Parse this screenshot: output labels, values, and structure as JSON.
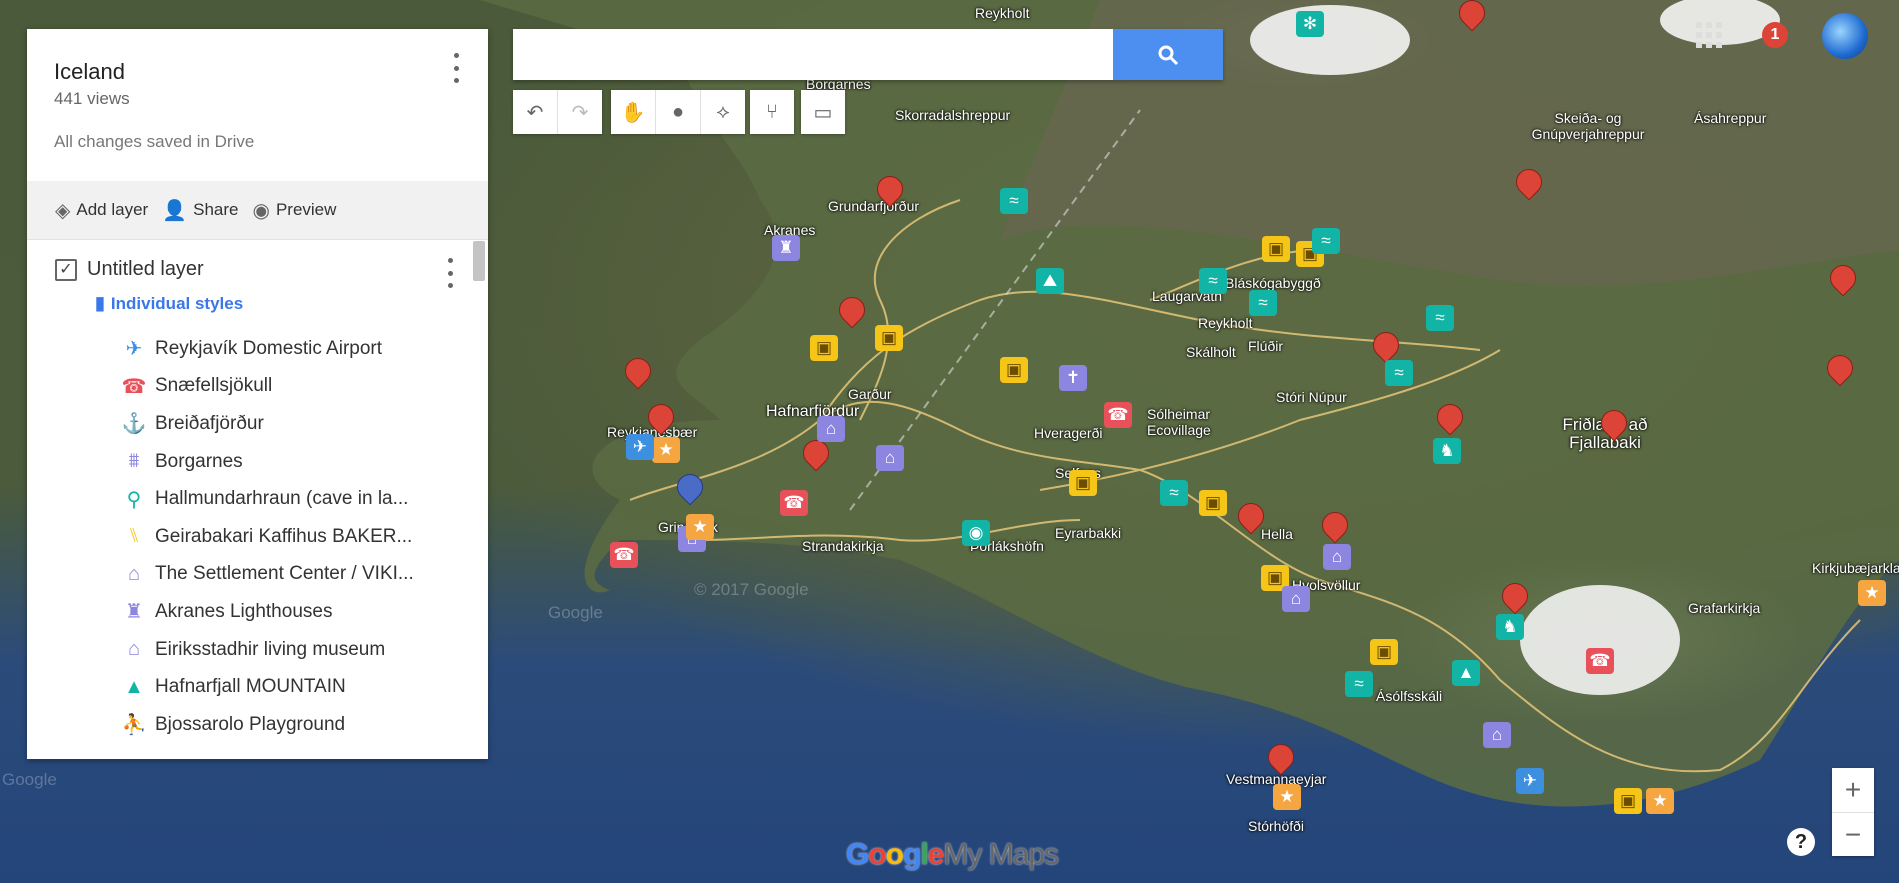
{
  "map": {
    "labels": [
      {
        "text": "Reykholt"
      },
      {
        "text": "Borgarnes"
      },
      {
        "text": "Skorradalshreppur"
      },
      {
        "text": "Grundarfjörður"
      },
      {
        "text": "Akranes"
      },
      {
        "text": "Laugarvatn"
      },
      {
        "text": "Bláskógabyggð"
      },
      {
        "text": "Reykholt"
      },
      {
        "text": "Skálholt"
      },
      {
        "text": "Flúðir"
      },
      {
        "text": "Stóri Núpur"
      },
      {
        "text": "Sólheimar Ecovillage"
      },
      {
        "text": "Reykjanesbær"
      },
      {
        "text": "Hafnarfjördur"
      },
      {
        "text": "Garður"
      },
      {
        "text": "Hveragerði"
      },
      {
        "text": "Selfoss"
      },
      {
        "text": "Eyrarbakki"
      },
      {
        "text": "Grindavík"
      },
      {
        "text": "Strandakirkja"
      },
      {
        "text": "Þorlákshöfn"
      },
      {
        "text": "Hella"
      },
      {
        "text": "Hvolsvöllur"
      },
      {
        "text": "Ásólfsskáli"
      },
      {
        "text": "Vestmannaeyjar"
      },
      {
        "text": "Stórhöfði"
      },
      {
        "text": "Skeiða- og Gnúpverjahreppur"
      },
      {
        "text": "Ásahreppur"
      },
      {
        "text": "Friðland að Fjallabaki"
      },
      {
        "text": "Kirkjubæjarklaustur"
      },
      {
        "text": "Grafarkirkja"
      }
    ],
    "watermarks": [
      "© 2017 Google",
      "Google",
      "Google"
    ]
  },
  "panel": {
    "title": "Iceland",
    "views": "441 views",
    "saved": "All changes saved in Drive",
    "actions": {
      "add_layer": "Add layer",
      "share": "Share",
      "preview": "Preview"
    },
    "layer": {
      "title": "Untitled layer",
      "styles": "Individual styles",
      "items": [
        {
          "label": "Reykjavík Domestic Airport",
          "icon": "airplane-icon",
          "color": "#3d8fe0"
        },
        {
          "label": "Snæfellsjökull",
          "icon": "volcano-icon",
          "color": "#e8515a"
        },
        {
          "label": "Breiðafjörður",
          "icon": "anchor-icon",
          "color": "#3d8fe0"
        },
        {
          "label": "Borgarnes",
          "icon": "bridge-icon",
          "color": "#8c86e0"
        },
        {
          "label": "Hallmundarhraun (cave in la...",
          "icon": "hiker-icon",
          "color": "#12b5a5"
        },
        {
          "label": "Geirabakari Kaffihus BAKER...",
          "icon": "restaurant-icon",
          "color": "#f5c518"
        },
        {
          "label": "The Settlement Center / VIKI...",
          "icon": "museum-icon",
          "color": "#8c86e0"
        },
        {
          "label": "Akranes Lighthouses",
          "icon": "lighthouse-icon",
          "color": "#8c86e0"
        },
        {
          "label": "Eiriksstadhir living museum",
          "icon": "museum-icon",
          "color": "#8c86e0"
        },
        {
          "label": "Hafnarfjall MOUNTAIN",
          "icon": "mountain-icon",
          "color": "#12b5a5"
        },
        {
          "label": "Bjossarolo Playground",
          "icon": "playground-icon",
          "color": "#8c86e0"
        }
      ]
    }
  },
  "search": {
    "placeholder": "",
    "button": "search-icon"
  },
  "toolbar": {
    "undo": "undo-icon",
    "redo": "redo-icon",
    "select": "hand-icon",
    "marker": "marker-icon",
    "line": "line-icon",
    "directions": "directions-icon",
    "measure": "ruler-icon"
  },
  "topbar": {
    "notifications": "1"
  },
  "zoom": {
    "in": "+",
    "out": "−"
  },
  "help": "?",
  "brand": {
    "g1": "G",
    "g2": "o",
    "g3": "o",
    "g4": "g",
    "g5": "l",
    "g6": "e",
    "suffix": "My Maps"
  }
}
